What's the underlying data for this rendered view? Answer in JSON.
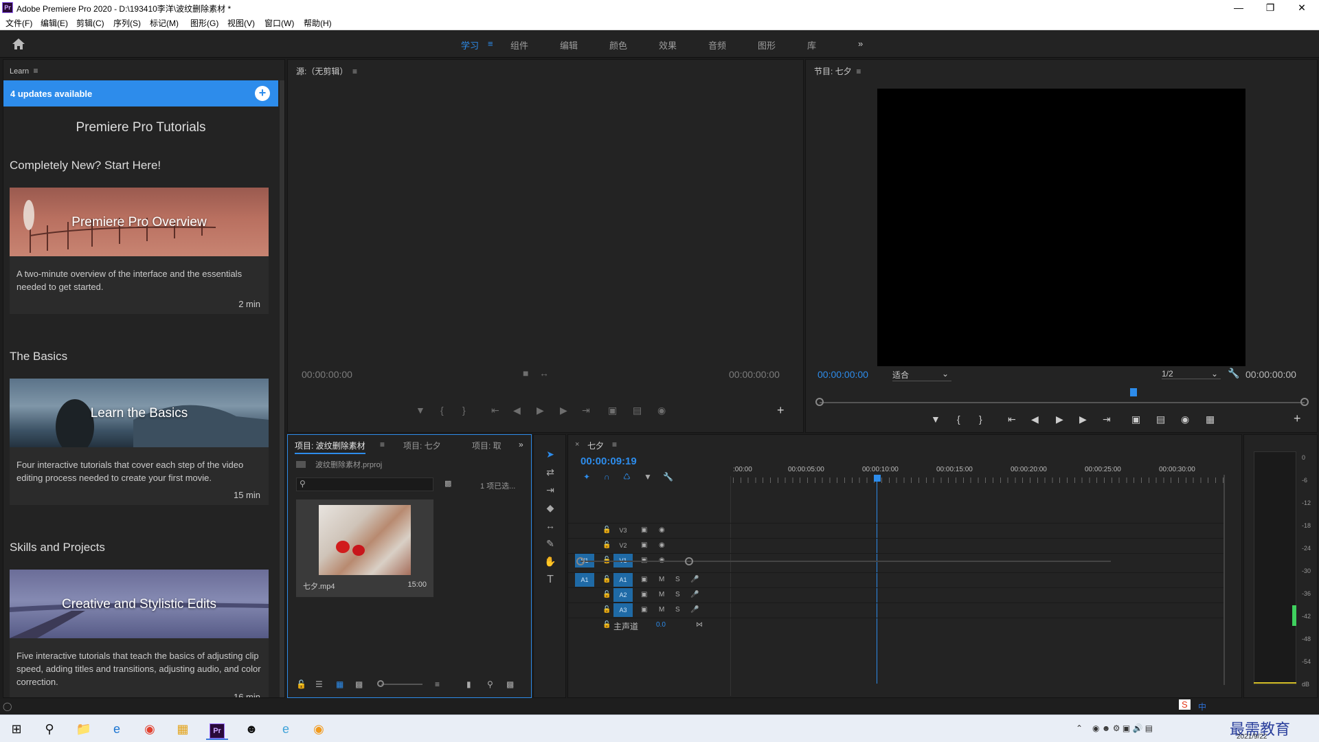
{
  "window": {
    "title": "Adobe Premiere Pro 2020 - D:\\193410李洋\\波纹删除素材 *",
    "logo": "Pr"
  },
  "menu": [
    "文件(F)",
    "编辑(E)",
    "剪辑(C)",
    "序列(S)",
    "标记(M)",
    "图形(G)",
    "视图(V)",
    "窗口(W)",
    "帮助(H)"
  ],
  "workspaces": {
    "items": [
      "学习",
      "组件",
      "编辑",
      "颜色",
      "效果",
      "音频",
      "图形",
      "库"
    ],
    "active": "学习",
    "overflow": "»"
  },
  "learn": {
    "panel_title": "Learn",
    "updates": "4 updates available",
    "heading": "Premiere Pro Tutorials",
    "sections": [
      {
        "title": "Completely New? Start Here!",
        "card_title": "Premiere Pro Overview",
        "desc": "A two-minute overview of the interface and the essentials needed to get started.",
        "duration": "2 min"
      },
      {
        "title": "The Basics",
        "card_title": "Learn the Basics",
        "desc": "Four interactive tutorials that cover each step of the video editing process needed to create your first movie.",
        "duration": "15 min"
      },
      {
        "title": "Skills and Projects",
        "card_title": "Creative and Stylistic Edits",
        "desc": "Five interactive tutorials that teach the basics of adjusting clip speed, adding titles and transitions, adjusting audio, and color correction.",
        "duration": "16 min"
      }
    ]
  },
  "source": {
    "title": "源:（无剪辑）",
    "tc_left": "00:00:00:00",
    "tc_right": "00:00:00:00"
  },
  "program": {
    "title": "节目: 七夕",
    "tc_left": "00:00:00:00",
    "fit": "适合",
    "resolution": "1/2",
    "tc_right": "00:00:00:00"
  },
  "project": {
    "tabs": [
      "项目: 波纹删除素材",
      "项目: 七夕",
      "项目: 取"
    ],
    "file": "波纹删除素材.prproj",
    "selected": "1 项已选...",
    "clip_name": "七夕.mp4",
    "clip_duration": "15:00"
  },
  "timeline": {
    "sequence": "七夕",
    "timecode": "00:00:09:19",
    "ruler": [
      ":00:00",
      "00:00:05:00",
      "00:00:10:00",
      "00:00:15:00",
      "00:00:20:00",
      "00:00:25:00",
      "00:00:30:00"
    ],
    "video_tracks": [
      "V3",
      "V2",
      "V1"
    ],
    "audio_tracks": [
      "A1",
      "A2",
      "A3"
    ],
    "source_patch_v": "V1",
    "source_patch_a": "A1",
    "master_label": "主声道",
    "master_value": "0.0",
    "mute": "M",
    "solo": "S"
  },
  "meter": {
    "scale": [
      "0",
      "-6",
      "-12",
      "-18",
      "-24",
      "-30",
      "-36",
      "-42",
      "-48",
      "-54",
      "dB"
    ]
  },
  "taskbar": {
    "date": "2021/9/22",
    "watermark": "最需教育",
    "ime": "中"
  }
}
